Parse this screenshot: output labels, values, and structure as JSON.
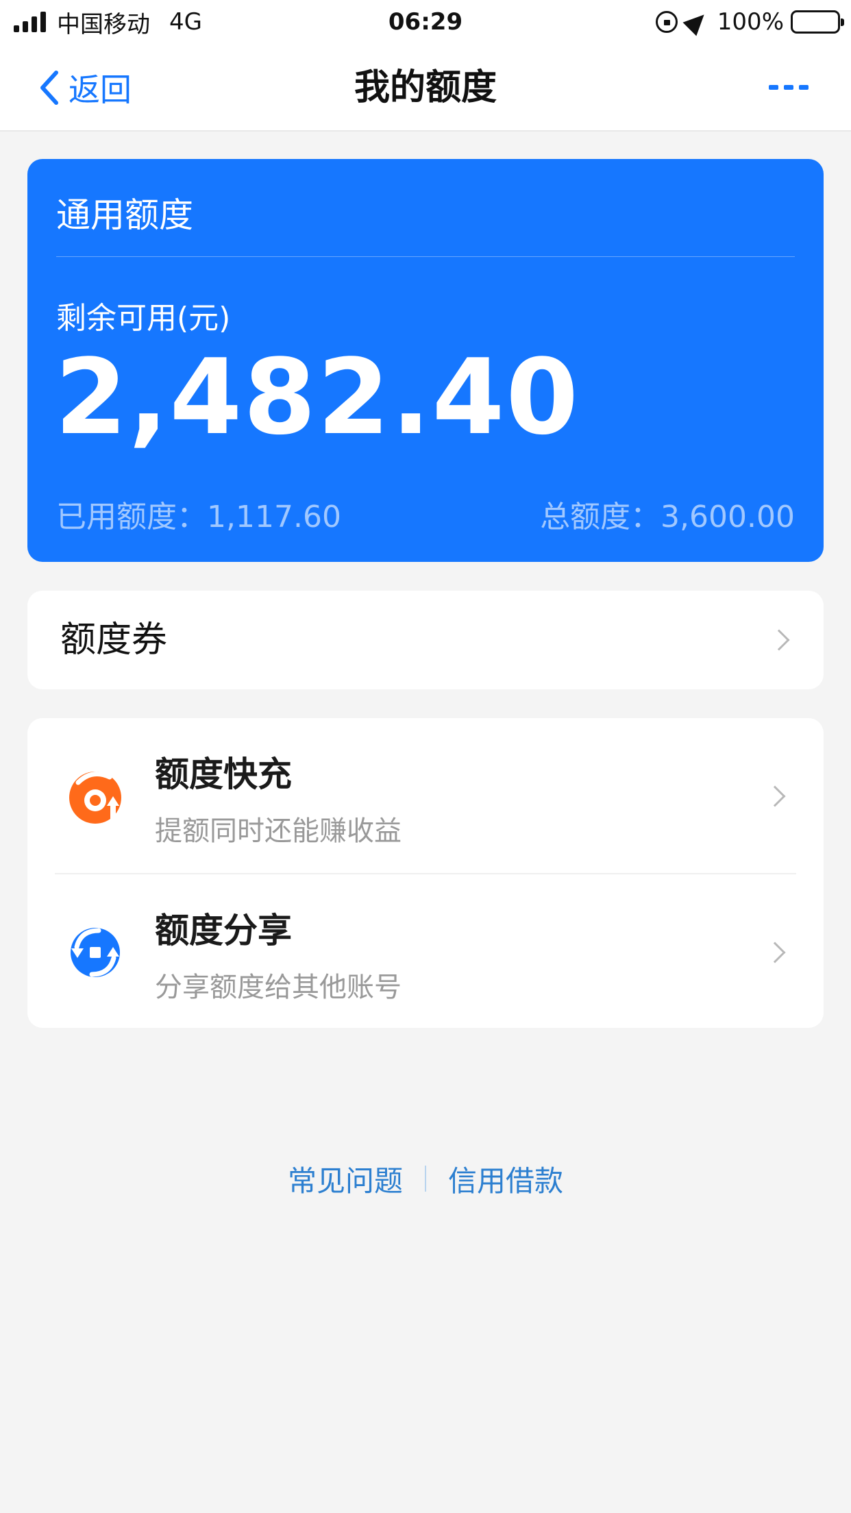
{
  "status_bar": {
    "carrier": "中国移动",
    "network": "4G",
    "time": "06:29",
    "battery": "100%"
  },
  "nav": {
    "back_label": "返回",
    "title": "我的额度"
  },
  "quota_card": {
    "title": "通用额度",
    "available_label": "剩余可用(元)",
    "available_amount": "2,482.40",
    "used_text": "已用额度：1,117.60",
    "total_text": "总额度：3,600.00",
    "color": "#1677ff"
  },
  "coupon": {
    "label": "额度券"
  },
  "features": [
    {
      "title": "额度快充",
      "subtitle": "提额同时还能赚收益",
      "icon": "quota-recharge-icon",
      "color": "#ff6a1a"
    },
    {
      "title": "额度分享",
      "subtitle": "分享额度给其他账号",
      "icon": "quota-share-icon",
      "color": "#1677ff"
    }
  ],
  "footer": {
    "faq": "常见问题",
    "credit_loan": "信用借款"
  }
}
